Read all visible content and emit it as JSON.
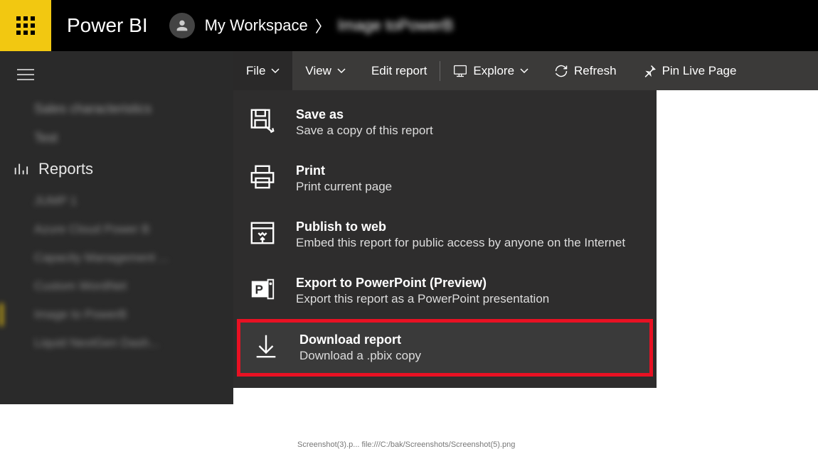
{
  "brand": "Power BI",
  "breadcrumb": {
    "workspace": "My Workspace",
    "sep": "〉",
    "current": "Image toPowerB"
  },
  "sidebar": {
    "blurred_top": [
      "Sales characteristics",
      "Test"
    ],
    "section": "Reports",
    "items": [
      {
        "label": "JUMP 1",
        "active": false
      },
      {
        "label": "Azure Cloud Power B",
        "active": false
      },
      {
        "label": "Capacity Management ...",
        "active": false
      },
      {
        "label": "Custom WordNet",
        "active": false
      },
      {
        "label": "Image to PowerB",
        "active": true
      },
      {
        "label": "Liquid NextGen Dash...",
        "active": false
      }
    ]
  },
  "toolbar": {
    "file": "File",
    "view": "View",
    "edit": "Edit report",
    "explore": "Explore",
    "refresh": "Refresh",
    "pin": "Pin Live Page"
  },
  "dropdown": {
    "items": [
      {
        "title": "Save as",
        "sub": "Save a copy of this report",
        "icon": "save-as-icon"
      },
      {
        "title": "Print",
        "sub": "Print current page",
        "icon": "print-icon"
      },
      {
        "title": "Publish to web",
        "sub": "Embed this report for public access by anyone on the Internet",
        "icon": "publish-web-icon"
      },
      {
        "title": "Export to PowerPoint (Preview)",
        "sub": "Export this report as a PowerPoint presentation",
        "icon": "powerpoint-icon"
      },
      {
        "title": "Download report",
        "sub": "Download a .pbix copy",
        "icon": "download-icon",
        "highlighted": true
      }
    ]
  },
  "leak": "Screenshot(3).p...    file:///C:/bak/Screenshots/Screenshot(5).png"
}
